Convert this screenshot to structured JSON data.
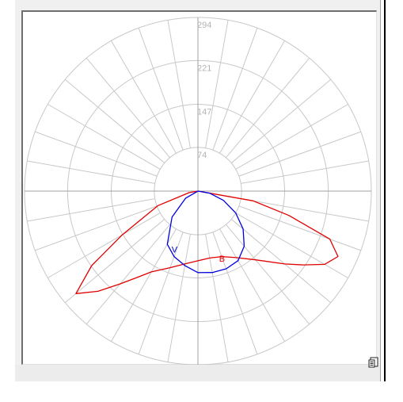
{
  "colors": {
    "grid": "#c8c8c8",
    "axis": "#a0a0a0",
    "curve_B": "#e00000",
    "curve_V": "#0000e0",
    "ring_label": "#b4b4b4"
  },
  "toolbar": {
    "export_icon": "export-icon"
  },
  "chart_data": {
    "type": "polar",
    "subtype": "luminous-intensity-distribution",
    "radial_ticks": [
      "74",
      "147",
      "221",
      "294"
    ],
    "rmax": 294,
    "angular_step_deg": 10,
    "series": [
      {
        "name": "B",
        "color": "#e00000",
        "points": [
          [
            -90,
            0
          ],
          [
            -80,
            15
          ],
          [
            -70,
            72
          ],
          [
            -60,
            148
          ],
          [
            -55,
            220
          ],
          [
            -50,
            270
          ],
          [
            -45,
            240
          ],
          [
            -40,
            205
          ],
          [
            -35,
            178
          ],
          [
            -30,
            158
          ],
          [
            -20,
            138
          ],
          [
            -10,
            125
          ],
          [
            0,
            118
          ],
          [
            10,
            115
          ],
          [
            20,
            118
          ],
          [
            30,
            130
          ],
          [
            40,
            152
          ],
          [
            50,
            192
          ],
          [
            55,
            218
          ],
          [
            60,
            248
          ],
          [
            65,
            262
          ],
          [
            70,
            238
          ],
          [
            75,
            160
          ],
          [
            80,
            95
          ],
          [
            90,
            0
          ]
        ]
      },
      {
        "name": "V",
        "color": "#0000e0",
        "points": [
          [
            -90,
            0
          ],
          [
            -60,
            24
          ],
          [
            -45,
            62
          ],
          [
            -30,
            104
          ],
          [
            -20,
            118
          ],
          [
            -10,
            128
          ],
          [
            0,
            138
          ],
          [
            10,
            140
          ],
          [
            20,
            140
          ],
          [
            30,
            136
          ],
          [
            40,
            122
          ],
          [
            50,
            100
          ],
          [
            60,
            74
          ],
          [
            70,
            46
          ],
          [
            80,
            20
          ],
          [
            90,
            0
          ]
        ]
      }
    ]
  }
}
